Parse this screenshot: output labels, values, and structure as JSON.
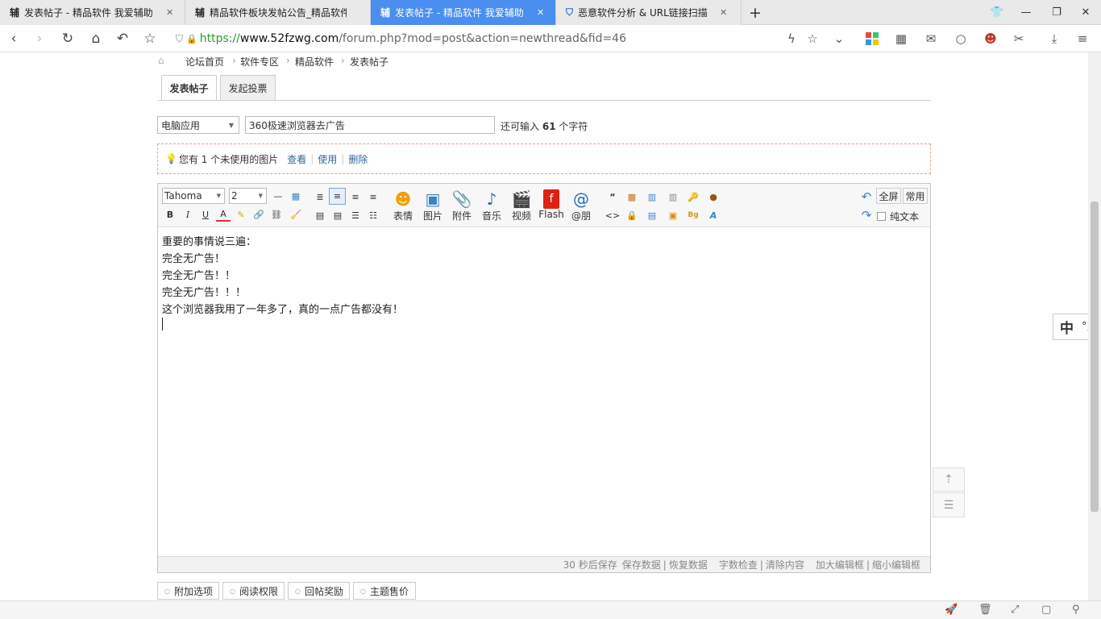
{
  "tabs": [
    {
      "favicon": "辅",
      "title": "发表帖子 - 精品软件 我爱辅助"
    },
    {
      "favicon": "辅",
      "title": "精品软件板块发帖公告_精品软件"
    },
    {
      "favicon": "辅",
      "title": "发表帖子 - 精品软件 我爱辅助"
    },
    {
      "favicon": "shield-icon",
      "title": "恶意软件分析 & URL链接扫描"
    }
  ],
  "address": {
    "scheme": "https://",
    "domain": "www.52fzwg.com",
    "path": "/forum.php?mod=post&action=newthread&fid=46"
  },
  "breadcrumb": [
    "论坛首页",
    "软件专区",
    "精品软件",
    "发表帖子"
  ],
  "post_tabs": [
    "发表帖子",
    "发起投票"
  ],
  "form": {
    "category": "电脑应用",
    "subject": "360极速浏览器去广告",
    "counter_pre": "还可输入",
    "counter_num": "61",
    "counter_post": "个字符"
  },
  "notice": {
    "text": "您有 1 个未使用的图片",
    "view": "查看",
    "use": "使用",
    "delete": "删除"
  },
  "editor": {
    "font": "Tahoma",
    "size": "2",
    "big_buttons": [
      "表情",
      "图片",
      "附件",
      "音乐",
      "视频",
      "Flash",
      "@朋"
    ],
    "fullscreen": "全屏",
    "common": "常用",
    "plain_text": "纯文本",
    "content": [
      "重要的事情说三遍：",
      "完全无广告！",
      "完全无广告！！",
      "完全无广告！！！",
      "这个浏览器我用了一年多了，真的一点广告都没有！"
    ],
    "status": {
      "autosave": "30 秒后保存",
      "save": "保存数据",
      "restore": "恢复数据",
      "check": "字数检查",
      "clear": "清除内容",
      "enlarge": "加大编辑框",
      "shrink": "缩小编辑框"
    }
  },
  "bottom_tabs": [
    "附加选项",
    "阅读权限",
    "回帖奖励",
    "主题售价"
  ],
  "ime": {
    "lang": "中",
    "punct": "°,"
  }
}
